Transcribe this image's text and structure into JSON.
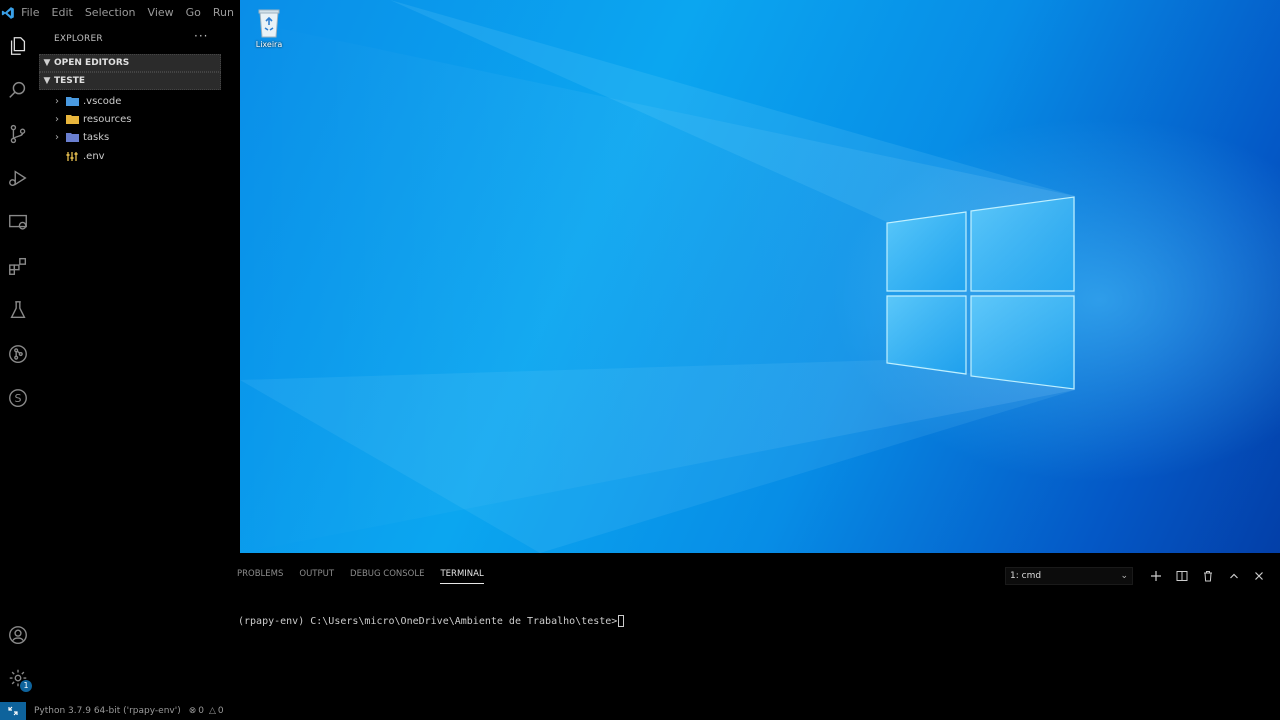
{
  "menu": [
    "File",
    "Edit",
    "Selection",
    "View",
    "Go",
    "Run"
  ],
  "activity_icons": [
    "explorer-icon",
    "search-icon",
    "source-control-icon",
    "run-debug-icon",
    "remote-explorer-icon",
    "extensions-icon",
    "testing-icon",
    "git-graph-icon",
    "s-extension-icon",
    "account-icon",
    "settings-gear-icon"
  ],
  "settings_badge": "1",
  "sidebar": {
    "title": "EXPLORER",
    "more": "···",
    "open_editors": "OPEN EDITORS",
    "folder": "TESTE",
    "items": [
      {
        "label": ".vscode",
        "kind": "folder",
        "color": "#4a9ae0"
      },
      {
        "label": "resources",
        "kind": "folder",
        "color": "#e8b53c"
      },
      {
        "label": "tasks",
        "kind": "folder",
        "color": "#6a7fd0"
      },
      {
        "label": ".env",
        "kind": "file",
        "color": "#d9b34a"
      }
    ]
  },
  "desktop": {
    "recycle_label": "Lixeira"
  },
  "panel": {
    "tabs": [
      "PROBLEMS",
      "OUTPUT",
      "DEBUG CONSOLE",
      "TERMINAL"
    ],
    "active_tab": "TERMINAL",
    "terminal_select": "1: cmd",
    "prompt": "(rpapy-env) C:\\Users\\micro\\OneDrive\\Ambiente de Trabalho\\teste>"
  },
  "status": {
    "interpreter": "Python 3.7.9 64-bit ('rpapy-env')",
    "errors": "0",
    "warnings": "0"
  },
  "colors": {
    "accent": "#0e639c",
    "desktop_blue": "#0ba6f0"
  }
}
